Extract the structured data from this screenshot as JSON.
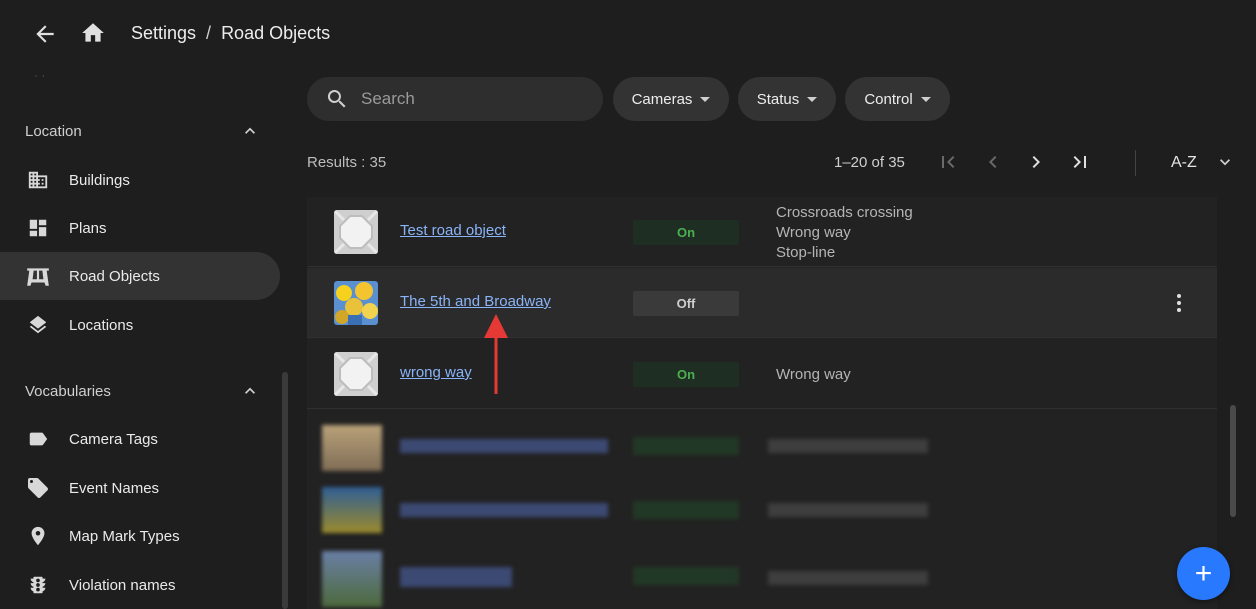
{
  "breadcrumb": {
    "root": "Settings",
    "separator": "/",
    "current": "Road Objects"
  },
  "sidebar": {
    "sections": [
      {
        "title": "Location",
        "expanded": true,
        "items": [
          {
            "label": "Buildings",
            "icon": "building-icon"
          },
          {
            "label": "Plans",
            "icon": "dashboard-icon"
          },
          {
            "label": "Road Objects",
            "icon": "road-icon",
            "active": true
          },
          {
            "label": "Locations",
            "icon": "layers-icon"
          }
        ]
      },
      {
        "title": "Vocabularies",
        "expanded": true,
        "items": [
          {
            "label": "Camera Tags",
            "icon": "label-icon"
          },
          {
            "label": "Event Names",
            "icon": "tags-icon"
          },
          {
            "label": "Map Mark Types",
            "icon": "map-pin-icon"
          },
          {
            "label": "Violation names",
            "icon": "traffic-light-icon"
          }
        ]
      }
    ]
  },
  "filters": {
    "search_placeholder": "Search",
    "chips": [
      "Cameras",
      "Status",
      "Control"
    ]
  },
  "list": {
    "results_label": "Results : 35",
    "range_label": "1–20 of 35",
    "sort_label": "A-Z",
    "rows": [
      {
        "name": "Test road object",
        "status": "On",
        "controls": [
          "Crossroads crossing",
          "Wrong way",
          "Stop-line"
        ]
      },
      {
        "name": "The 5th and Broadway",
        "status": "Off",
        "controls": []
      },
      {
        "name": "wrong way",
        "status": "On",
        "controls": [
          "Wrong way"
        ]
      }
    ]
  },
  "colors": {
    "accent": "#2979ff",
    "link": "#8ab4f8",
    "on": "#4caf50",
    "arrow": "#e53935"
  }
}
